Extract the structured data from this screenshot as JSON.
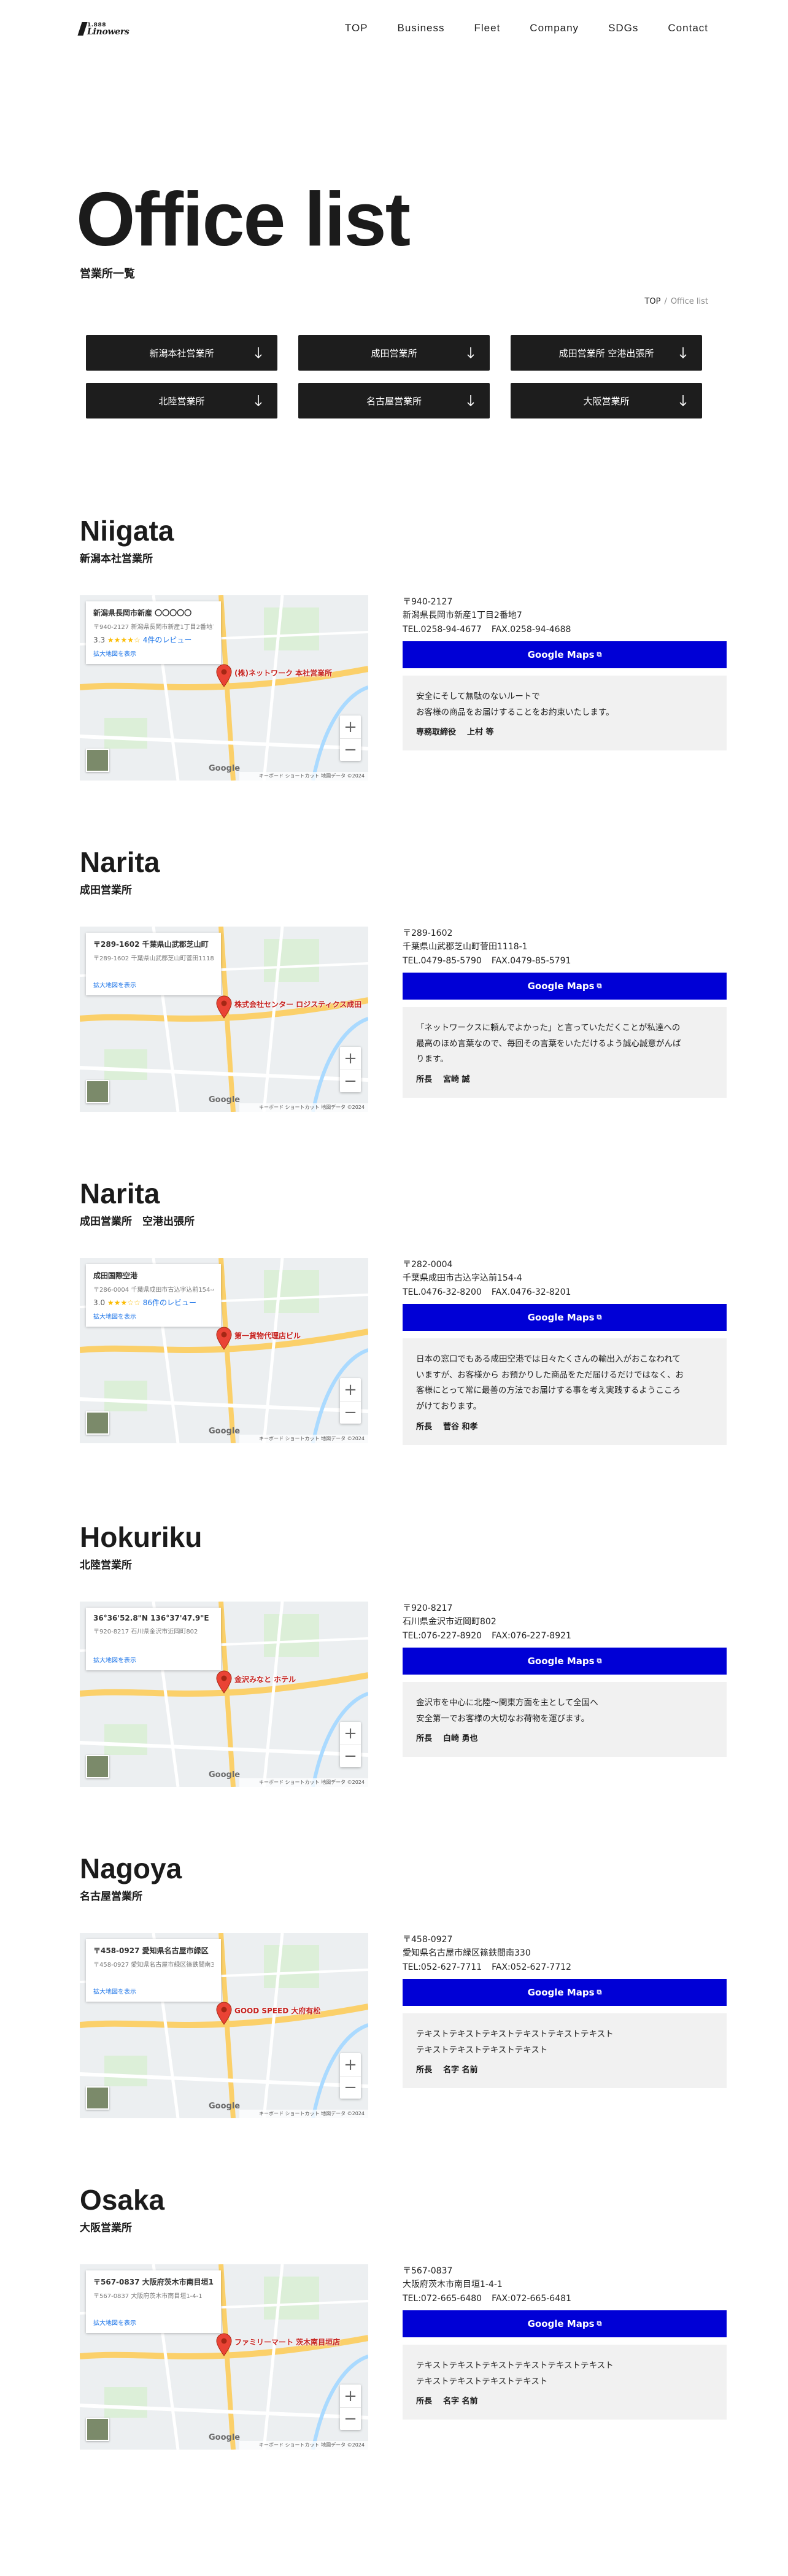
{
  "logo": {
    "small": "1.888",
    "big": "Linowers"
  },
  "nav": [
    "TOP",
    "Business",
    "Fleet",
    "Company",
    "SDGs",
    "Contact"
  ],
  "hero": {
    "title": "Office list",
    "subtitle": "営業所一覧"
  },
  "breadcrumb": {
    "home": "TOP",
    "separator": "/",
    "current": "Office list"
  },
  "anchors": [
    "新潟本社営業所",
    "成田営業所",
    "成田営業所 空港出張所",
    "北陸営業所",
    "名古屋営業所",
    "大阪営業所"
  ],
  "offices": [
    {
      "title": "Niigata",
      "subtitle": "新潟本社営業所",
      "map": {
        "line1": "新潟県長岡市新産 〇〇〇〇〇",
        "line2": "〒940-2127 新潟県長岡市新産1丁目2番地7",
        "rating": "3.3",
        "stars": "★★★★☆",
        "reviews": "4件のレビュー",
        "bigmap": "拡大地図を表示",
        "pin_label": "(株)ネットワーク 本社営業所"
      },
      "zip": "〒940-2127",
      "address": "新潟県長岡市新産1丁目2番地7",
      "tel": "TEL.0258-94-4677",
      "fax": "FAX.0258-94-4688",
      "button": "Google Maps",
      "message": "安全にそして無駄のないルートで\nお客様の商品をお届けすることをお約束いたします。",
      "role": "専務取締役",
      "name": "上村 等"
    },
    {
      "title": "Narita",
      "subtitle": "成田営業所",
      "map": {
        "line1": "〒289-1602 千葉県山武郡芝山町",
        "line2": "〒289-1602 千葉県山武郡芝山町菅田1118-1",
        "rating": "",
        "stars": "",
        "reviews": "",
        "bigmap": "拡大地図を表示",
        "pin_label": "株式会社センター ロジスティクス成田"
      },
      "zip": "〒289-1602",
      "address": "千葉県山武郡芝山町菅田1118-1",
      "tel": "TEL.0479-85-5790",
      "fax": "FAX.0479-85-5791",
      "button": "Google Maps",
      "message": "「ネットワークスに頼んでよかった」と言っていただくことが私達への\n最高のほめ言葉なので、毎回その言葉をいただけるよう誠心誠意がんば\nります。",
      "role": "所長",
      "name": "宮崎 誠"
    },
    {
      "title": "Narita",
      "subtitle": "成田営業所　空港出張所",
      "map": {
        "line1": "成田国際空港",
        "line2": "〒286-0004 千葉県成田市古込字込前154-4",
        "rating": "3.0",
        "stars": "★★★☆☆",
        "reviews": "86件のレビュー",
        "bigmap": "拡大地図を表示",
        "pin_label": "第一貨物代理店ビル"
      },
      "zip": "〒282-0004",
      "address": "千葉県成田市古込字込前154-4",
      "tel": "TEL.0476-32-8200",
      "fax": "FAX.0476-32-8201",
      "button": "Google Maps",
      "message": "日本の窓口でもある成田空港では日々たくさんの輸出入がおこなわれて\nいますが、お客様から お預かりした商品をただ届けるだけではなく、お\n客様にとって常に最善の方法でお届けする事を考え実践するようこころ\nがけております。",
      "role": "所長",
      "name": "菅谷 和孝"
    },
    {
      "title": "Hokuriku",
      "subtitle": "北陸営業所",
      "map": {
        "line1": "36°36'52.8\"N 136°37'47.9\"E",
        "line2": "〒920-8217 石川県金沢市近岡町802",
        "rating": "",
        "stars": "",
        "reviews": "",
        "bigmap": "拡大地図を表示",
        "pin_label": "金沢みなと ホテル"
      },
      "zip": "〒920-8217",
      "address": "石川県金沢市近岡町802",
      "tel": "TEL:076-227-8920",
      "fax": "FAX:076-227-8921",
      "button": "Google Maps",
      "message": "金沢市を中心に北陸〜関東方面を主として全国へ\n安全第一でお客様の大切なお荷物を運びます。",
      "role": "所長",
      "name": "白崎 勇也"
    },
    {
      "title": "Nagoya",
      "subtitle": "名古屋営業所",
      "map": {
        "line1": "〒458-0927 愛知県名古屋市緑区",
        "line2": "〒458-0927 愛知県名古屋市緑区篠鉄間南330",
        "rating": "",
        "stars": "",
        "reviews": "",
        "bigmap": "拡大地図を表示",
        "pin_label": "GOOD SPEED 大府有松"
      },
      "zip": "〒458-0927",
      "address": "愛知県名古屋市緑区篠鉄間南330",
      "tel": "TEL:052-627-7711",
      "fax": "FAX:052-627-7712",
      "button": "Google Maps",
      "message": "テキストテキストテキストテキストテキストテキスト\nテキストテキストテキストテキスト",
      "role": "所長",
      "name": "名字 名前"
    },
    {
      "title": "Osaka",
      "subtitle": "大阪営業所",
      "map": {
        "line1": "〒567-0837 大阪府茨木市南目垣1-4-1",
        "line2": "〒567-0837 大阪府茨木市南目垣1-4-1",
        "rating": "",
        "stars": "",
        "reviews": "",
        "bigmap": "拡大地図を表示",
        "pin_label": "ファミリーマート 茨木南目垣店"
      },
      "zip": "〒567-0837",
      "address": "大阪府茨木市南目垣1-4-1",
      "tel": "TEL:072-665-6480",
      "fax": "FAX:072-665-6481",
      "button": "Google Maps",
      "message": "テキストテキストテキストテキストテキストテキスト\nテキストテキストテキストテキスト",
      "role": "所長",
      "name": "名字 名前"
    }
  ],
  "map_common": {
    "google": "Google",
    "attribution": "キーボード ショートカット  地図データ ©2024",
    "zoom_in": "+",
    "zoom_out": "−",
    "ext_icon": "⧉"
  },
  "colors": {
    "button_blue": "#0000d6",
    "dark_button": "#1d1d1d",
    "panel": "#f1f1f1",
    "pin": "#ea4335"
  }
}
